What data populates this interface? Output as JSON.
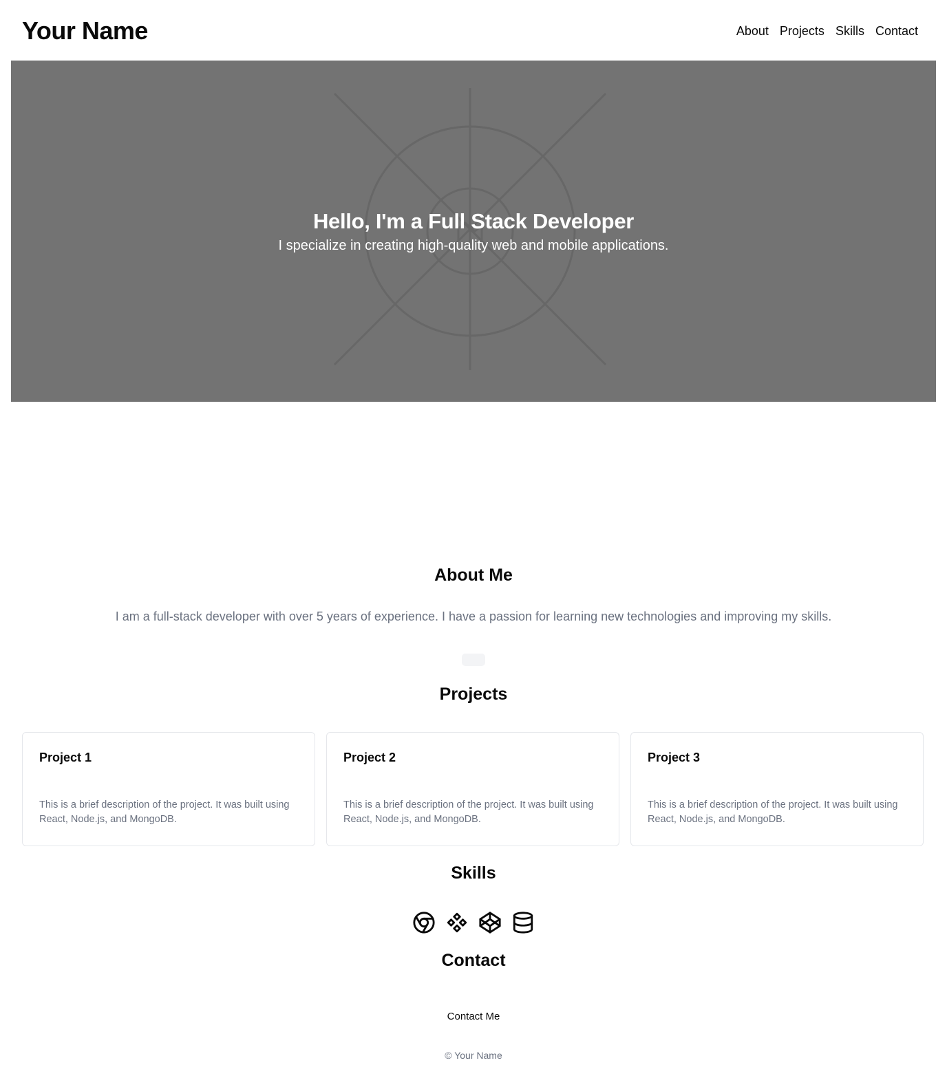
{
  "header": {
    "logo": "Your Name",
    "nav": [
      {
        "label": "About"
      },
      {
        "label": "Projects"
      },
      {
        "label": "Skills"
      },
      {
        "label": "Contact"
      }
    ]
  },
  "hero": {
    "title": "Hello, I'm a Full Stack Developer",
    "subtitle": "I specialize in creating high-quality web and mobile applications.",
    "background_color": "#737373"
  },
  "about": {
    "title": "About Me",
    "text": "I am a full-stack developer with over 5 years of experience. I have a passion for learning new technologies and improving my skills."
  },
  "projects": {
    "title": "Projects",
    "items": [
      {
        "title": "Project 1",
        "description": "This is a brief description of the project. It was built using React, Node.js, and MongoDB."
      },
      {
        "title": "Project 2",
        "description": "This is a brief description of the project. It was built using React, Node.js, and MongoDB."
      },
      {
        "title": "Project 3",
        "description": "This is a brief description of the project. It was built using React, Node.js, and MongoDB."
      }
    ]
  },
  "skills": {
    "title": "Skills",
    "icons": [
      "chrome-icon",
      "figma-icon",
      "codepen-icon",
      "database-icon"
    ]
  },
  "contact": {
    "title": "Contact",
    "button_label": "Contact Me"
  },
  "footer": {
    "text": "© Your Name"
  }
}
